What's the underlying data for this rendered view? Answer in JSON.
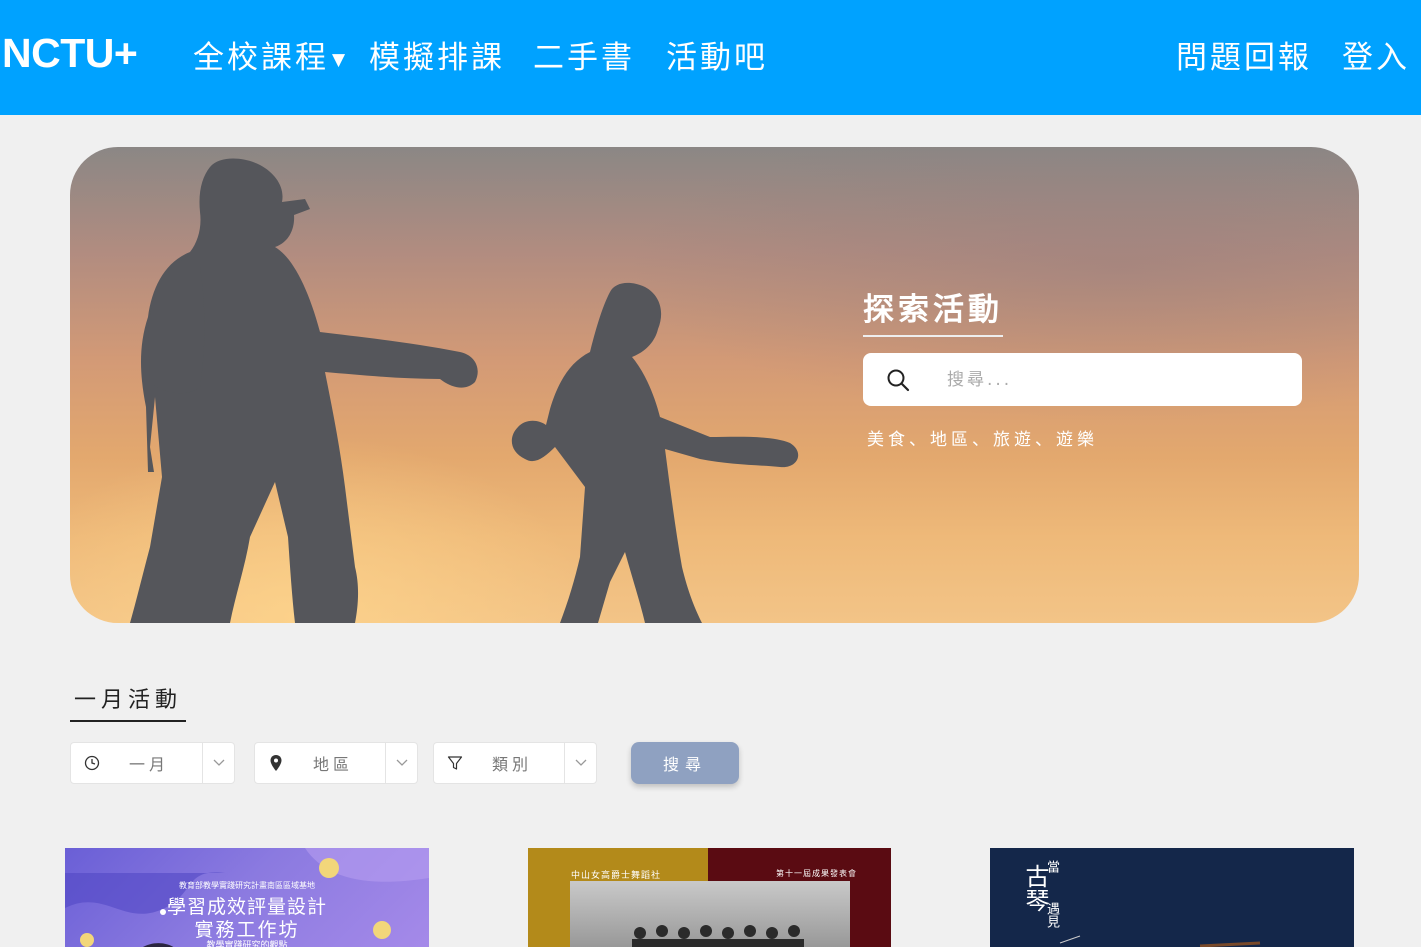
{
  "navbar": {
    "logo": "NCTU+",
    "items": [
      {
        "label": "全校課程",
        "has_dropdown": true
      },
      {
        "label": "模擬排課"
      },
      {
        "label": "二手書"
      },
      {
        "label": "活動吧"
      }
    ],
    "right_items": [
      {
        "label": "問題回報"
      },
      {
        "label": "登入"
      }
    ],
    "bg_color": "#00a2ff"
  },
  "hero": {
    "title": "探索活動",
    "search_placeholder": "搜尋...",
    "search_icon": "search-icon",
    "tags": "美食、地區、旅遊、遊樂"
  },
  "section": {
    "title": "一月活動"
  },
  "filters": [
    {
      "icon": "clock-icon",
      "label": "一月"
    },
    {
      "icon": "location-pin-icon",
      "label": "地區"
    },
    {
      "icon": "filter-icon",
      "label": "類別"
    }
  ],
  "search_button": {
    "label": "搜尋",
    "color": "#8fa1c1"
  },
  "cards": [
    {
      "line1": "教育部教學實踐研究計畫南區區域基地",
      "line2": "學習成效評量設計",
      "line3": "實務工作坊",
      "line4": "教學實踐研究的觀點"
    },
    {
      "left_text": "中山女高爵士舞蹈社",
      "right_text": "第十一屆成果發表會"
    },
    {
      "big": "古琴",
      "small1": "當",
      "small2": "遇見"
    }
  ]
}
